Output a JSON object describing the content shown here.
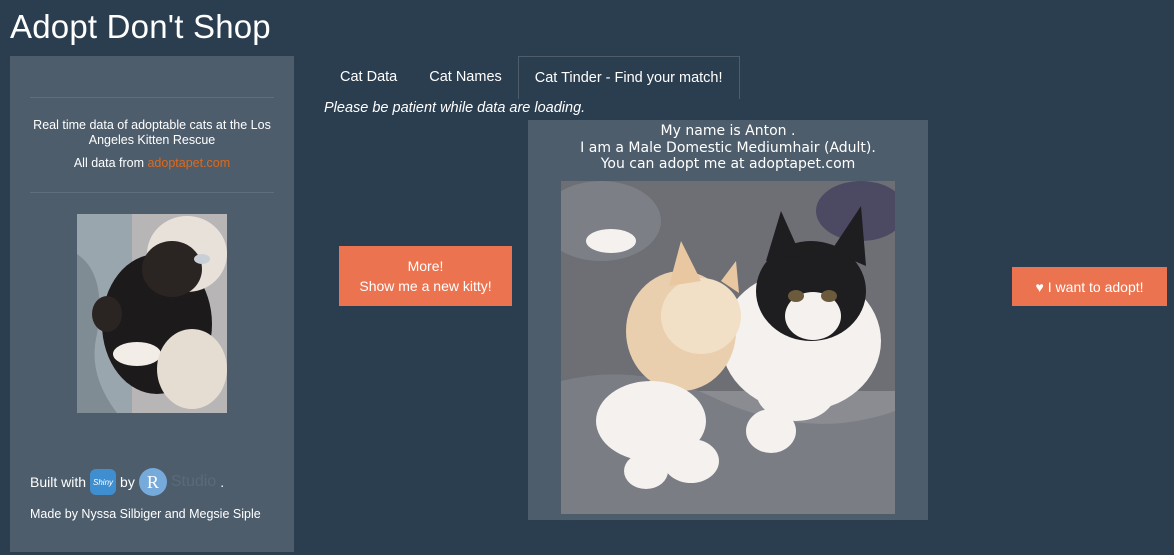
{
  "app": {
    "title": "Adopt Don't Shop"
  },
  "sidebar": {
    "description": "Real time data of adoptable cats at the Los Angeles Kitten Rescue",
    "source_prefix": "All data from ",
    "source_link": "adoptapet.com",
    "built_with": "Built with",
    "shiny_logo_text": "Shiny",
    "by": "by",
    "r_logo_text": "R",
    "studio_text": "Studio",
    "period": ".",
    "made_by": "Made by Nyssa Silbiger and Megsie Siple"
  },
  "tabs": [
    {
      "label": "Cat Data",
      "active": false
    },
    {
      "label": "Cat Names",
      "active": false
    },
    {
      "label": "Cat Tinder - Find your match!",
      "active": true
    }
  ],
  "main": {
    "loading_note": "Please be patient while data are loading.",
    "more_button": {
      "line1": "More!",
      "line2": "Show me a new kitty!"
    },
    "cat": {
      "line1": "My name is Anton .",
      "line2": "I am a Male Domestic Mediumhair (Adult).",
      "line3": "You can adopt me at adoptapet.com"
    },
    "adopt_button": {
      "icon": "heart-icon",
      "label": "I want to adopt!"
    }
  },
  "colors": {
    "background": "#2b3e50",
    "panel": "#4e5d6c",
    "accent": "#ec7350",
    "link": "#df691a"
  }
}
